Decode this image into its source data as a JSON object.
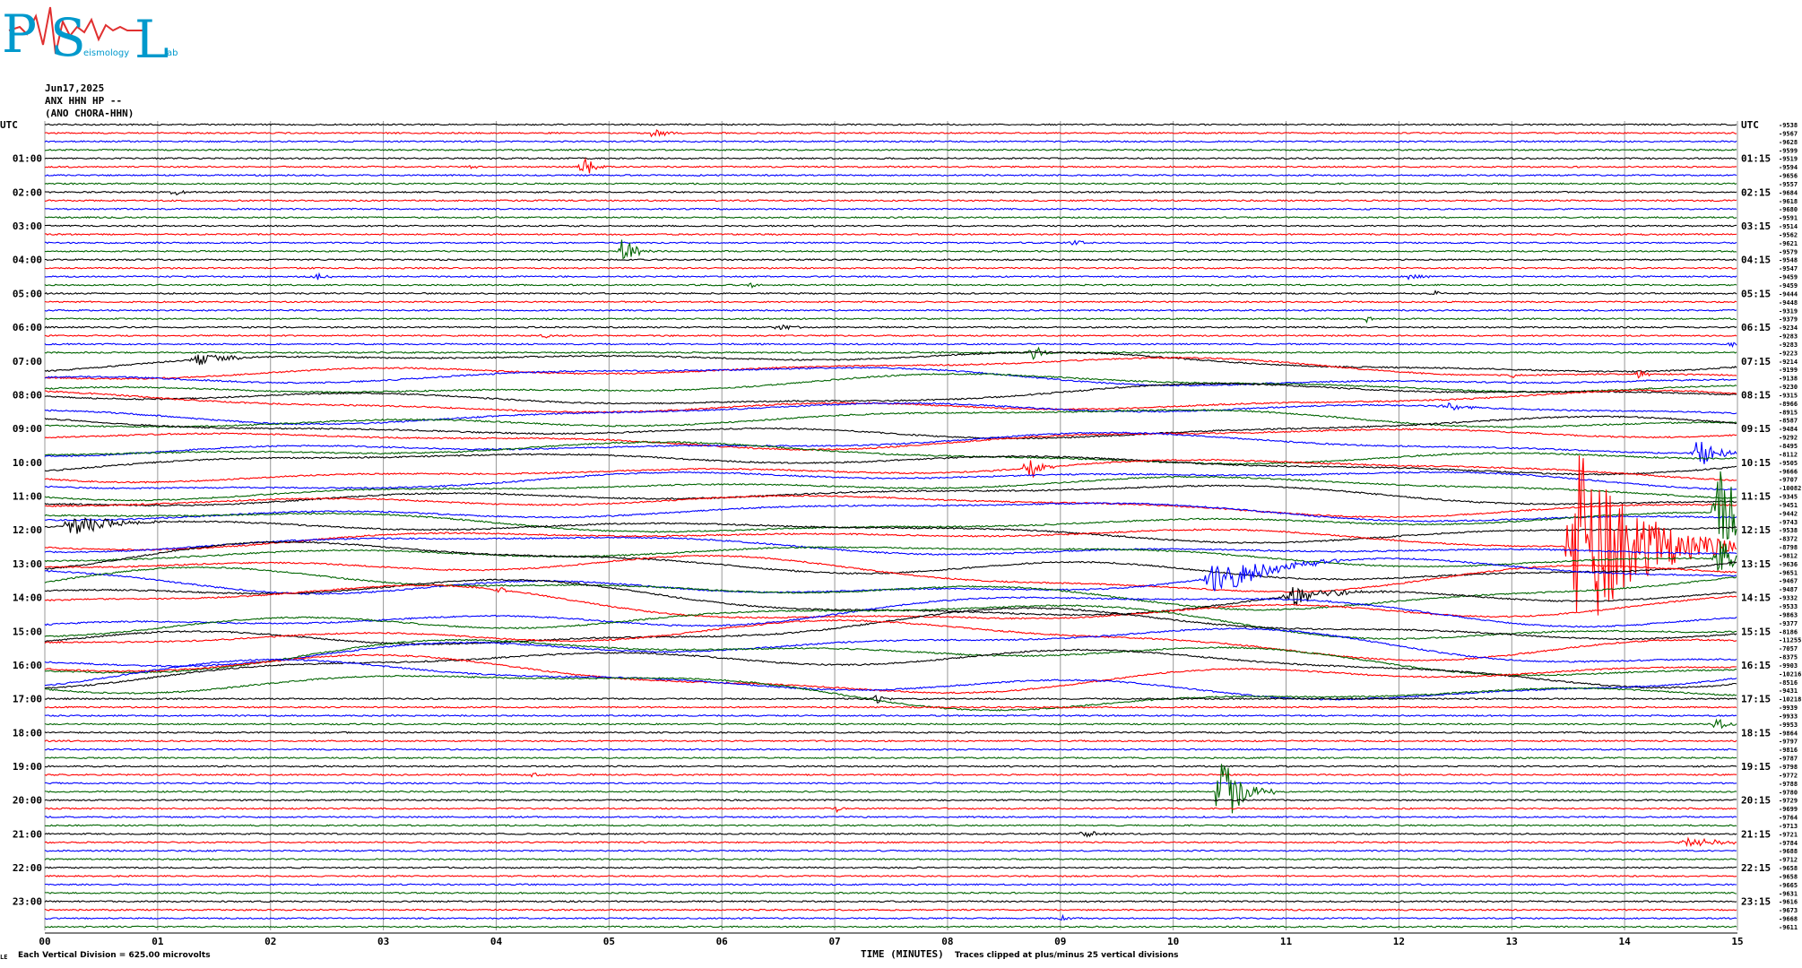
{
  "logo": {
    "letters": [
      "P",
      "S",
      "L"
    ],
    "words": [
      "",
      "eismology",
      "ab"
    ],
    "colors": [
      "#0099cc",
      "#e03030"
    ]
  },
  "header": {
    "date": "Jun17,2025",
    "channel": "ANX HHN HP --",
    "station": "(ANO CHORA-HHN)"
  },
  "chart_data": {
    "type": "line",
    "title": "",
    "xlabel": "TIME (MINUTES)",
    "x_ticks": [
      "00",
      "01",
      "02",
      "03",
      "04",
      "05",
      "06",
      "07",
      "08",
      "09",
      "10",
      "11",
      "12",
      "13",
      "14",
      "15"
    ],
    "xlim": [
      0,
      15
    ],
    "left_axis_title": "UTC",
    "right_axis_title": "UTC",
    "left_hour_labels": [
      "01:00",
      "02:00",
      "03:00",
      "04:00",
      "05:00",
      "06:00",
      "07:00",
      "08:00",
      "09:00",
      "10:00",
      "11:00",
      "12:00",
      "13:00",
      "14:00",
      "15:00",
      "16:00",
      "17:00",
      "18:00",
      "19:00",
      "20:00",
      "21:00",
      "22:00",
      "23:00"
    ],
    "right_hour_labels": [
      "01:15",
      "02:15",
      "03:15",
      "04:15",
      "05:15",
      "06:15",
      "07:15",
      "08:15",
      "09:15",
      "10:15",
      "11:15",
      "12:15",
      "13:15",
      "14:15",
      "15:15",
      "16:15",
      "17:15",
      "18:15",
      "19:15",
      "20:15",
      "21:15",
      "22:15",
      "23:15"
    ],
    "rows_per_hour": 4,
    "trace_colors": [
      "#000000",
      "#ff0000",
      "#0000ff",
      "#006400"
    ],
    "trace_offsets": [
      "-9538",
      "-9567",
      "-9628",
      "-9599",
      "-9519",
      "-9594",
      "-9656",
      "-9557",
      "-9684",
      "-9618",
      "-9680",
      "-9591",
      "-9514",
      "-9562",
      "-9621",
      "-9579",
      "-9548",
      "-9547",
      "-9459",
      "-9459",
      "-9444",
      "-9448",
      "-9319",
      "-9379",
      "-9234",
      "-9283",
      "-9283",
      "-9223",
      "-9214",
      "-9199",
      "-9138",
      "-9230",
      "-9315",
      "-8966",
      "-8915",
      "-8587",
      "-9484",
      "-9292",
      "-8495",
      "-8112",
      "-9505",
      "-9666",
      "-9707",
      "-10082",
      "-9345",
      "-9451",
      "-9442",
      "-9743",
      "-9538",
      "-8372",
      "-8798",
      "-9812",
      "-9636",
      "-9651",
      "-9467",
      "-9487",
      "-9332",
      "-9533",
      "-9863",
      "-9377",
      "-8186",
      "-11255",
      "-7057",
      "-8375",
      "-9903",
      "-10216",
      "-8516",
      "-9431",
      "-10218",
      "-9939",
      "-9933",
      "-9953",
      "-9864",
      "-9797",
      "-9816",
      "-9787",
      "-9798",
      "-9772",
      "-9788",
      "-9780",
      "-9729",
      "-9699",
      "-9764",
      "-9713",
      "-9721",
      "-9784",
      "-9688",
      "-9712",
      "-9658",
      "-9658",
      "-9665",
      "-9631",
      "-9616",
      "-9673",
      "-9668",
      "-9611"
    ],
    "events": [
      {
        "row": 1,
        "minute": 5.35,
        "amp": 0.45,
        "dur": 0.35
      },
      {
        "row": 5,
        "minute": 4.75,
        "amp": 1.2,
        "dur": 0.25
      },
      {
        "row": 5,
        "minute": 3.75,
        "amp": 0.3,
        "dur": 0.15
      },
      {
        "row": 8,
        "minute": 1.15,
        "amp": 0.45,
        "dur": 0.2
      },
      {
        "row": 14,
        "minute": 9.1,
        "amp": 0.4,
        "dur": 0.2
      },
      {
        "row": 15,
        "minute": 5.1,
        "amp": 1.5,
        "dur": 0.3
      },
      {
        "row": 18,
        "minute": 2.4,
        "amp": 0.4,
        "dur": 0.25
      },
      {
        "row": 18,
        "minute": 12.1,
        "amp": 0.5,
        "dur": 0.25
      },
      {
        "row": 19,
        "minute": 6.25,
        "amp": 0.3,
        "dur": 0.2
      },
      {
        "row": 20,
        "minute": 12.3,
        "amp": 0.3,
        "dur": 0.2
      },
      {
        "row": 23,
        "minute": 11.7,
        "amp": 0.3,
        "dur": 0.15
      },
      {
        "row": 24,
        "minute": 6.5,
        "amp": 0.35,
        "dur": 0.3
      },
      {
        "row": 25,
        "minute": 4.4,
        "amp": 0.3,
        "dur": 0.2
      },
      {
        "row": 26,
        "minute": 14.95,
        "amp": 0.4,
        "dur": 0.1
      },
      {
        "row": 27,
        "minute": 8.75,
        "amp": 0.9,
        "dur": 0.2
      },
      {
        "row": 28,
        "minute": 1.3,
        "amp": 0.5,
        "dur": 1.0
      },
      {
        "row": 29,
        "minute": 14.1,
        "amp": 0.4,
        "dur": 0.3
      },
      {
        "row": 29,
        "minute": 13.0,
        "amp": 0.3,
        "dur": 0.1
      },
      {
        "row": 34,
        "minute": 12.4,
        "amp": 0.4,
        "dur": 0.5
      },
      {
        "row": 38,
        "minute": 14.6,
        "amp": 1.6,
        "dur": 0.5
      },
      {
        "row": 41,
        "minute": 8.7,
        "amp": 1.3,
        "dur": 0.3
      },
      {
        "row": 48,
        "minute": 0.2,
        "amp": 1.3,
        "dur": 0.8
      },
      {
        "row": 49,
        "minute": 13.5,
        "amp": 9.0,
        "dur": 1.6
      },
      {
        "row": 47,
        "minute": 14.8,
        "amp": 4.5,
        "dur": 0.6
      },
      {
        "row": 51,
        "minute": 14.8,
        "amp": 1.8,
        "dur": 0.6
      },
      {
        "row": 54,
        "minute": 10.3,
        "amp": 1.8,
        "dur": 1.3
      },
      {
        "row": 56,
        "minute": 11.0,
        "amp": 1.0,
        "dur": 1.0
      },
      {
        "row": 57,
        "minute": 4.0,
        "amp": 0.4,
        "dur": 0.2
      },
      {
        "row": 68,
        "minute": 7.35,
        "amp": 0.5,
        "dur": 0.2
      },
      {
        "row": 71,
        "minute": 14.8,
        "amp": 0.6,
        "dur": 0.3
      },
      {
        "row": 79,
        "minute": 10.4,
        "amp": 3.5,
        "dur": 0.5
      },
      {
        "row": 77,
        "minute": 4.3,
        "amp": 0.4,
        "dur": 0.15
      },
      {
        "row": 81,
        "minute": 7.0,
        "amp": 0.3,
        "dur": 0.2
      },
      {
        "row": 84,
        "minute": 9.2,
        "amp": 0.35,
        "dur": 0.3
      },
      {
        "row": 85,
        "minute": 14.5,
        "amp": 0.45,
        "dur": 1.0
      },
      {
        "row": 94,
        "minute": 9.0,
        "amp": 0.3,
        "dur": 0.2
      }
    ],
    "footer_left": "Each Vertical Division =  625.00 microvolts",
    "footer_right": "Traces clipped at plus/minus 25 vertical divisions",
    "corner_mark": "LE"
  }
}
